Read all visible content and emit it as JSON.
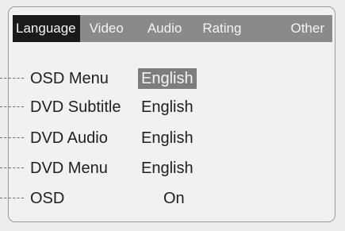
{
  "tabs": [
    {
      "label": "Language",
      "active": true
    },
    {
      "label": "Video",
      "active": false
    },
    {
      "label": "Audio",
      "active": false
    },
    {
      "label": "Rating",
      "active": false
    },
    {
      "label": "Other",
      "active": false
    }
  ],
  "rows": [
    {
      "label": "OSD Menu",
      "value": "English",
      "selected": true
    },
    {
      "label": "DVD Subtitle",
      "value": "English",
      "selected": false
    },
    {
      "label": "DVD Audio",
      "value": "English",
      "selected": false
    },
    {
      "label": "DVD Menu",
      "value": "English",
      "selected": false
    },
    {
      "label": "OSD",
      "value": "On",
      "selected": false
    }
  ],
  "colors": {
    "tabbar": "#8a8a8a",
    "active_tab": "#1a1a1a",
    "selected_value": "#7d7d7d",
    "text": "#202020"
  }
}
